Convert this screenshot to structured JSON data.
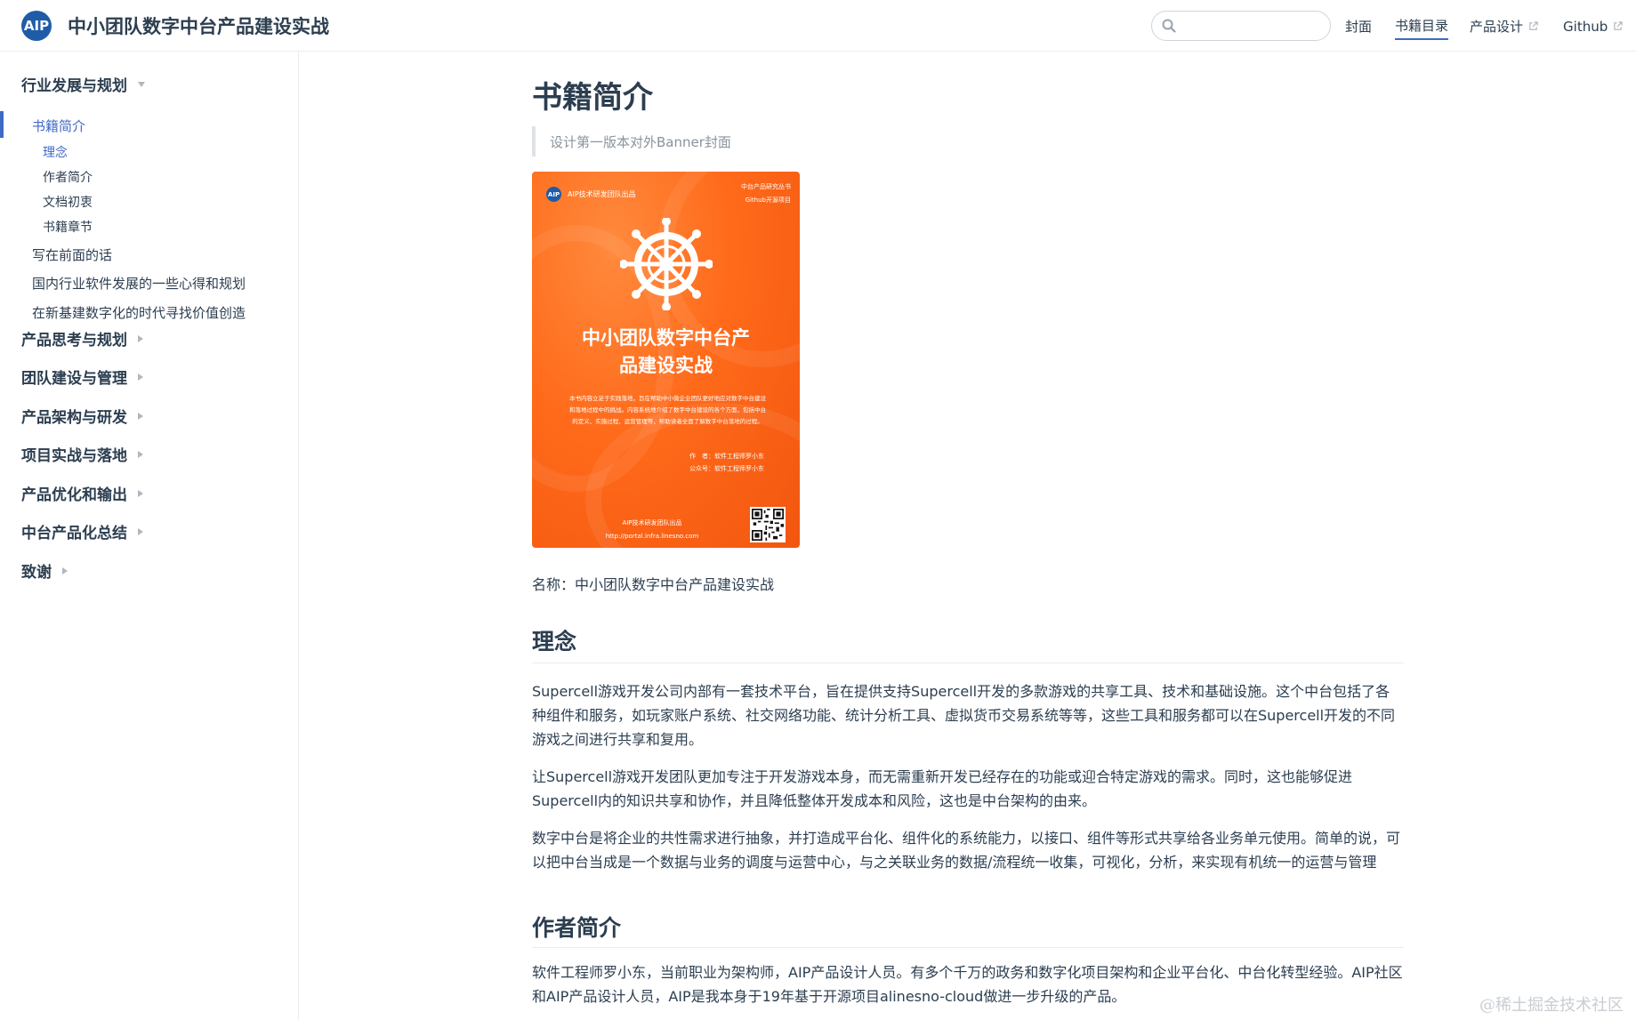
{
  "brand": {
    "logo_text": "AIP",
    "title": "中小团队数字中台产品建设实战"
  },
  "search": {
    "placeholder": "",
    "value": ""
  },
  "nav": {
    "cover": "封面",
    "toc": "书籍目录",
    "design": "产品设计",
    "github": "Github"
  },
  "sidebar": {
    "group_1": "行业发展与规划",
    "intro": "书籍简介",
    "sub_idea": "理念",
    "sub_author": "作者简介",
    "sub_origin": "文档初衷",
    "sub_chapters": "书籍章节",
    "preface": "写在前面的话",
    "domestic": "国内行业软件发展的一些心得和规划",
    "new_infra": "在新基建数字化的时代寻找价值创造",
    "group_2": "产品思考与规划",
    "group_3": "团队建设与管理",
    "group_4": "产品架构与研发",
    "group_5": "项目实战与落地",
    "group_6": "产品优化和输出",
    "group_7": "中台产品化总结",
    "group_8": "致谢"
  },
  "content": {
    "title": "书籍简介",
    "quote": "设计第一版本对外Banner封面",
    "name_line": "名称：中小团队数字中台产品建设实战",
    "h_idea": "理念",
    "p1": "Supercell游戏开发公司内部有一套技术平台，旨在提供支持Supercell开发的多款游戏的共享工具、技术和基础设施。这个中台包括了各种组件和服务，如玩家账户系统、社交网络功能、统计分析工具、虚拟货币交易系统等等，这些工具和服务都可以在Supercell开发的不同游戏之间进行共享和复用。",
    "p2": "让Supercell游戏开发团队更加专注于开发游戏本身，而无需重新开发已经存在的功能或迎合特定游戏的需求。同时，这也能够促进Supercell内的知识共享和协作，并且降低整体开发成本和风险，这也是中台架构的由来。",
    "p3": "数字中台是将企业的共性需求进行抽象，并打造成平台化、组件化的系统能力，以接口、组件等形式共享给各业务单元使用。简单的说，可以把中台当成是一个数据与业务的调度与运营中心，与之关联业务的数据/流程统一收集，可视化，分析，来实现有机统一的运营与管理",
    "h_author": "作者简介",
    "p4": "软件工程师罗小东，当前职业为架构师，AIP产品设计人员。有多个千万的政务和数字化项目架构和企业平台化、中台化转型经验。AIP社区和AIP产品设计人员，AIP是我本身于19年基于开源项目alinesno-cloud做进一步升级的产品。"
  },
  "cover": {
    "logo": "AIP",
    "publisher": "AIP技术研发团队出品",
    "series_1": "中台产品研究丛书",
    "series_2": "Github开源项目",
    "title_1": "中小团队数字中台产",
    "title_2": "品建设实战",
    "desc": "本书内容立足于实践落地，旨在帮助中小微企业团队更好地应对数字中台建设和落地过程中的挑战。内容系统地介绍了数字中台建设的各个方面，包括中台的定义、实施过程、运营管理等，帮助读者全面了解数字中台落地的过程。",
    "author": "作　者：软件工程师罗小东",
    "wechat": "公众号：软件工程师罗小东",
    "foot_1": "AIP技术研发团队出品",
    "foot_2": "http://portal.infra.linesno.com"
  },
  "watermark": "@稀土掘金技术社区",
  "colors": {
    "accent": "#3f6ac4",
    "cover_orange": "#f2560f",
    "logo_blue": "#1f5ca8",
    "text": "#2c3e50"
  }
}
